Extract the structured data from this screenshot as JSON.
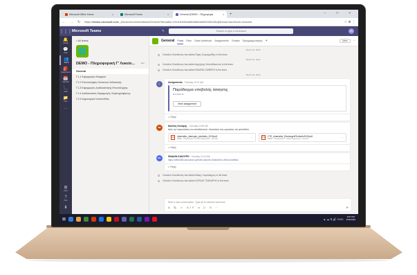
{
  "browser": {
    "tabs": [
      {
        "label": "Microsoft Office Home",
        "fav_color": "#d83b01",
        "close": "x",
        "active": false
      },
      {
        "label": "Microsoft Forms",
        "fav_color": "#007c77",
        "close": "x",
        "active": false
      },
      {
        "label": "General (DEMO - Πληροφορικ",
        "fav_color": "#6264a7",
        "close": "x",
        "active": true
      }
    ],
    "new_tab": "+",
    "window_controls": "– □ ×",
    "nav": {
      "back": "←",
      "forward": "→",
      "reload": "↻"
    },
    "url_prefix": "https://",
    "url_host": "teams.microsoft.com",
    "url_path": "/_#/school/conversations/General?threadId=19:be51b5b46fb0d8b0bd5f163fe33c@thread.tacv2&ctx=channel",
    "toolbar_icons": "☆ ⊕ ⋮"
  },
  "teams": {
    "waffle": "⋮⋮⋮",
    "app_title": "Microsoft Teams",
    "compose_icon": "✎",
    "search_placeholder": "Search or type a command",
    "me_initials": "ΠΚ"
  },
  "rail": [
    {
      "glyph": "🔔",
      "label": "Activity",
      "active": false
    },
    {
      "glyph": "💬",
      "label": "Chat",
      "active": false
    },
    {
      "glyph": "👥",
      "label": "Teams",
      "active": true
    },
    {
      "glyph": "🎒",
      "label": "Assignments",
      "active": false
    },
    {
      "glyph": "📅",
      "label": "Calendar",
      "active": false
    },
    {
      "glyph": "📞",
      "label": "Calls",
      "active": false
    },
    {
      "glyph": "📁",
      "label": "Files",
      "active": false
    },
    {
      "glyph": "···",
      "label": "",
      "active": false
    }
  ],
  "rail_bottom": [
    {
      "glyph": "⊞",
      "label": "Apps"
    },
    {
      "glyph": "?",
      "label": "Help"
    },
    {
      "glyph": "⬇",
      "label": ""
    }
  ],
  "pane": {
    "back_label": "< All teams",
    "team_logo": "🌐",
    "team_name": "DEMO - Πληροφορική Γ' Λυκείο...",
    "team_more": "···",
    "channels": [
      {
        "name": "General",
        "selected": true
      },
      {
        "name": "Γ1.1 Εφαρμογές Μορφών",
        "selected": false
      },
      {
        "name": "Γ1.2 Επαναλήψεις Κατανοώ Διδακτικής",
        "selected": false
      },
      {
        "name": "Γ1.3 Εφαρμογές Διαδικαστικής Επανάληψης",
        "selected": false
      },
      {
        "name": "Γ1.4 Διαδικτυακές Εφαρμογές Χαρτογράφησης",
        "selected": false
      },
      {
        "name": "Γ1.5 Δημιουργία Ιστοσελίδας",
        "selected": false
      }
    ]
  },
  "channel_header": {
    "title": "General",
    "tabs": [
      "Posts",
      "Files",
      "Class Notebook",
      "Assignments",
      "Grades",
      "Προγραμματισμός"
    ],
    "active_tab": 0,
    "add_tab": "+",
    "meet_label": "Meet",
    "more": "···"
  },
  "feed": {
    "date1": "March 22, 2020",
    "sys1": "Κλεοθών Κλεοθένους has added Παρις Σουρουμαΐδης to the team.",
    "date2": "March 23, 2020",
    "sys2": "Κλεοθών Κλεοθένους has added Δημήτρης Σπανοδάκουλος to the team.",
    "sys3": "Κλεοθών Κλεοθένους has added ΦΑΙΔΡΑΣ ΖΑΦΕΙΡΗ to the team.",
    "date3": "March 24, 2020",
    "assignment": {
      "avatar": "✓",
      "author": "Assignments",
      "time": "Tuesday 10:37 AM",
      "title": "Παράδειγμα υποβολής άσκησης",
      "due": "Due Mar 31",
      "button": "View assignment",
      "reply": "↩ Reply"
    },
    "post2": {
      "avatar": "NK",
      "author": "Νικόλας Κουάρης",
      "time": "Tuesday 10:59 AM",
      "body": "Δείτε την παρουσίαση του εκπαιδευτικού. Απαντήστε στις ερωτήσεις του φυλλαδίου.",
      "files": [
        {
          "icon": "PDF",
          "name": "dnarnaldo_ofamogm_pirofaslio_2018.pdf",
          "path": "DEMO - Πληροφορική Γ' Λυκείου Εφαρμογές > General",
          "more": "···"
        },
        {
          "icon": "PDF",
          "name": "CTE_dnarnaldo_ElarmogesPirofaclio2018.pdf",
          "path": "DEMO - Πληροφορική Γ' Λυκείου Εφαρμογές > General",
          "more": "···"
        }
      ],
      "reply": "↩ Reply"
    },
    "post3": {
      "avatar": "ΕΚ",
      "author": "ΦΑΙΔΩΝ ΚΑΚΟΥΡΗ",
      "time": "Tuesday 11:03 AM",
      "link": "https://office365.schoolcse.cy/index.php/cte-christo/ene-christo-mathitas",
      "reply": "↩ Reply"
    },
    "sys4": "Κλεοθών Κλεοθένους has added Μάκης Χωριτάκηρος to the team.",
    "sys5": "Κλεοθών Κλεοθένους has added ΛΟΡΚΑΣ ΤΣΑΚΙΑΡΗΣ to the team."
  },
  "compose": {
    "placeholder": "Start a new conversation. Type @ to mention someone.",
    "tools": "A 📎 ☺ GIF ▭ ▷ ⊙ ⋯",
    "send": "➤"
  },
  "taskbar": {
    "start": "⊞",
    "apps": [
      "#2d7dd2",
      "#e8a33d",
      "#3c8d2f",
      "#d83b01",
      "#1a73e8",
      "#f2c811",
      "#c50f1f",
      "#6264a7",
      "#217346",
      "#2b579a",
      "#7719aa",
      "#e81123"
    ],
    "tray": "▲ ☁ ⇅ 🔊 ENG",
    "time": "9:57 PM",
    "date": "3/24/2020"
  },
  "colors": {
    "teams_purple": "#464775",
    "accent": "#6264a7",
    "rail_bg": "#33344a"
  }
}
